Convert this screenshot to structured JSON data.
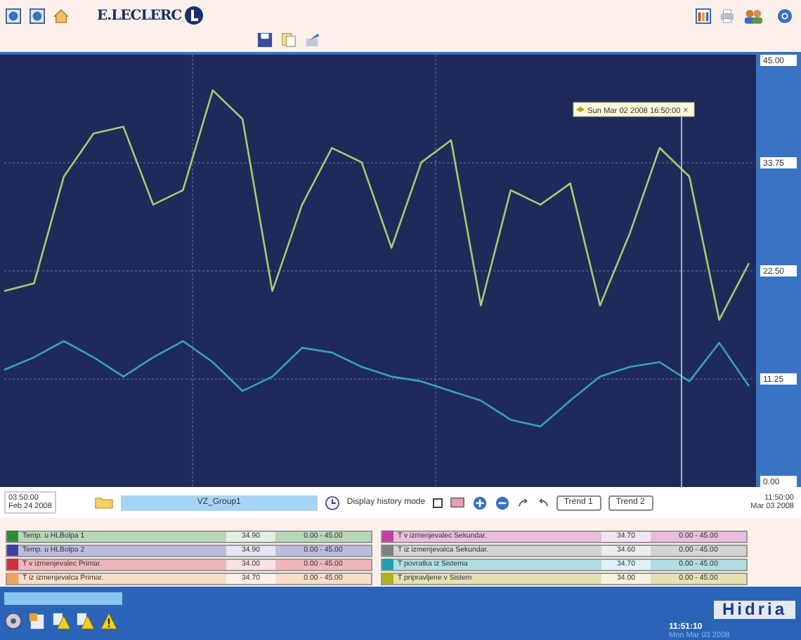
{
  "toolbar": {
    "logo_text": "E.LECLERC"
  },
  "chart": {
    "tooltip": {
      "text": "Sun Mar 02 2008 16:50:00",
      "close": "×"
    },
    "chart_data": {
      "type": "line",
      "grid": true,
      "ylim": [
        0,
        45
      ],
      "yticks": [
        {
          "value": 0,
          "label": "0.00"
        },
        {
          "value": 11.25,
          "label": "11.25"
        },
        {
          "value": 22.5,
          "label": "22.50"
        },
        {
          "value": 33.75,
          "label": "33.75"
        },
        {
          "value": 45,
          "label": "45.00"
        }
      ],
      "series": [
        {
          "color": "#9fd070",
          "values": [
            20.4,
            21.2,
            32.3,
            36.8,
            37.5,
            29.4,
            30.9,
            41.3,
            38.3,
            20.4,
            29.4,
            35.3,
            33.8,
            24.9,
            33.8,
            36.1,
            18.9,
            30.9,
            29.4,
            31.6,
            18.9,
            26.4,
            35.3,
            32.3,
            17.4,
            23.3
          ]
        },
        {
          "color": "#3aa0b8",
          "values": [
            12.2,
            13.5,
            15.2,
            13.5,
            11.5,
            13.5,
            15.2,
            13,
            10,
            11.5,
            14.5,
            14,
            12.5,
            11.5,
            11,
            10,
            9,
            7,
            6.3,
            9,
            11.5,
            12.5,
            13,
            11,
            15,
            10.5
          ]
        }
      ]
    }
  },
  "controls": {
    "start_time": "03:50:00",
    "start_date": "Feb 24 2008",
    "group": "VZ_Group1",
    "history_label": "Display history mode",
    "history_checked": false,
    "trend_buttons": [
      "Trend 1",
      "Trend 2"
    ],
    "end_time": "11:50:00",
    "end_date": "Mar 03 2008"
  },
  "legend": [
    {
      "name": "Temp. u HLBolpa 1",
      "value": "34.90",
      "range": "0.00 - 45.00",
      "color": "#2e8b3a"
    },
    {
      "name": "Temp. u HLBolpa 2",
      "value": "34.90",
      "range": "0.00 - 45.00",
      "color": "#4040a0"
    },
    {
      "name": "T v izmenjevalec Primar.",
      "value": "34.00",
      "range": "0.00 - 45.00",
      "color": "#d03040"
    },
    {
      "name": "T iz izmenjevalca Primar.",
      "value": "34.70",
      "range": "0.00 - 45.00",
      "color": "#f0a060"
    },
    {
      "name": "T v izmenjevalec Sekundar.",
      "value": "34.70",
      "range": "0.00 - 45.00",
      "color": "#c040a0"
    },
    {
      "name": "T iz izmenjevalca Sekundar.",
      "value": "34.60",
      "range": "0.00 - 45.00",
      "color": "#808080"
    },
    {
      "name": "T povratka iz Sistema",
      "value": "34.70",
      "range": "0.00 - 45.00",
      "color": "#20a0b0"
    },
    {
      "name": "T pripravljene v Sistem",
      "value": "34.00",
      "range": "0.00 - 45.00",
      "color": "#b0b020"
    }
  ],
  "footer": {
    "logo_text": "Hidria",
    "time": "11:51:10",
    "date": "Mon Mar 03 2008"
  }
}
